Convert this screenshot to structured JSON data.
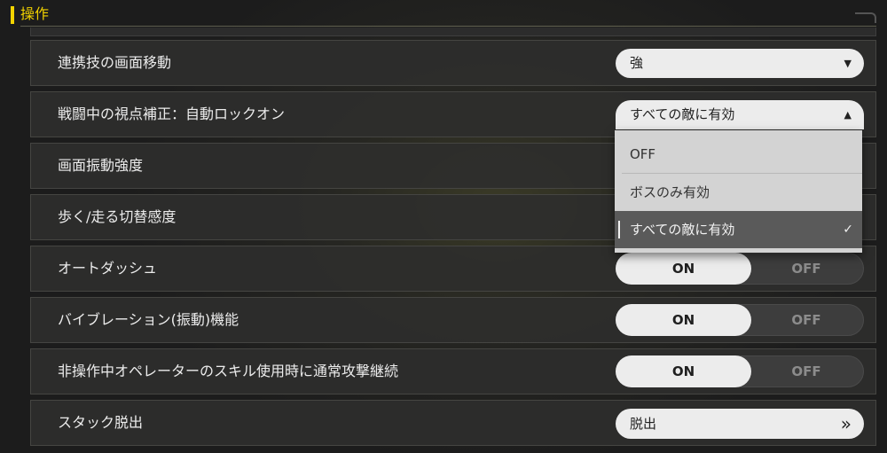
{
  "section": {
    "title": "操作"
  },
  "rows": [
    {
      "label": "連携技の画面移動",
      "control": "select",
      "value": "強",
      "icon": "caret-down-icon"
    },
    {
      "label": "戦闘中の視点補正：自動ロックオン",
      "control": "select",
      "value": "すべての敵に有効",
      "icon": "caret-up-icon",
      "open": true
    },
    {
      "label": "画面振動強度"
    },
    {
      "label": "歩く/走る切替感度"
    },
    {
      "label": "オートダッシュ",
      "control": "toggle",
      "on_label": "ON",
      "off_label": "OFF",
      "selected": "ON"
    },
    {
      "label": "バイブレーション(振動)機能",
      "control": "toggle",
      "on_label": "ON",
      "off_label": "OFF",
      "selected": "ON"
    },
    {
      "label": "非操作中オペレーターのスキル使用時に通常攻撃継続",
      "control": "toggle",
      "on_label": "ON",
      "off_label": "OFF",
      "selected": "ON"
    },
    {
      "label": "スタック脱出",
      "control": "button",
      "value": "脱出",
      "icon": "double-chevron-right-icon"
    }
  ],
  "dropdown": {
    "options": [
      {
        "label": "OFF",
        "selected": false
      },
      {
        "label": "ボスのみ有効",
        "selected": false
      },
      {
        "label": "すべての敵に有効",
        "selected": true
      }
    ],
    "check_icon": "checkmark-icon"
  },
  "colors": {
    "accent": "#f4d400",
    "row_background": "#2e2e2c",
    "control_light": "#ececec",
    "dropdown_background": "#d3d3d3",
    "dropdown_selected": "#5a5a5a"
  }
}
